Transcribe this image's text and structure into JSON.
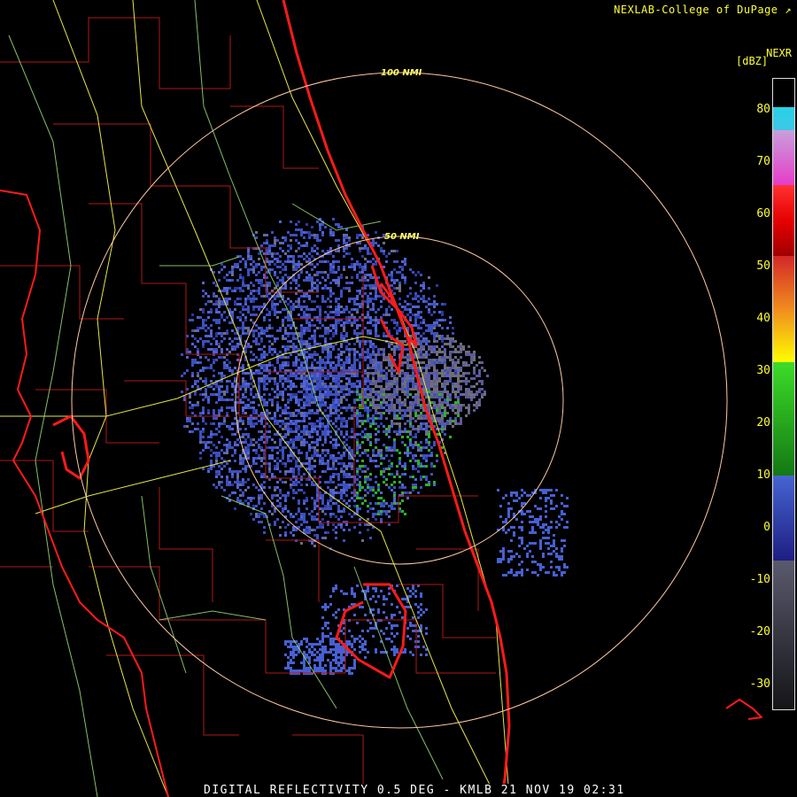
{
  "header": {
    "credit": "NEXLAB-College of DuPage",
    "credit_icon": "external-link-icon",
    "product": "NEXR",
    "units": "[dBZ]"
  },
  "range_rings": [
    {
      "label": "100 NMI"
    },
    {
      "label": "50 NMI"
    }
  ],
  "colorbar": {
    "ticks": [
      "80",
      "70",
      "60",
      "50",
      "40",
      "30",
      "20",
      "10",
      "0",
      "-10",
      "-20",
      "-30"
    ],
    "colors": {
      "cyan": "#28d2e6",
      "magenta": "#e63cc8",
      "red": "#e60000",
      "orange": "#f08c1e",
      "yellow": "#ffff00",
      "green_light": "#3cdc28",
      "green_dark": "#147814",
      "blue": "#4664d2",
      "gray": "#5a5a6e",
      "dark": "#141418"
    }
  },
  "footer": {
    "caption": "DIGITAL REFLECTIVITY 0.5 DEG - KMLB 21 NOV 19 02:31"
  },
  "map_colors": {
    "coast": "#ff1a1a",
    "county": "#b01818",
    "roads": "#e6e64a",
    "roads2": "#9be07a",
    "ring": "#ffc8a0"
  }
}
